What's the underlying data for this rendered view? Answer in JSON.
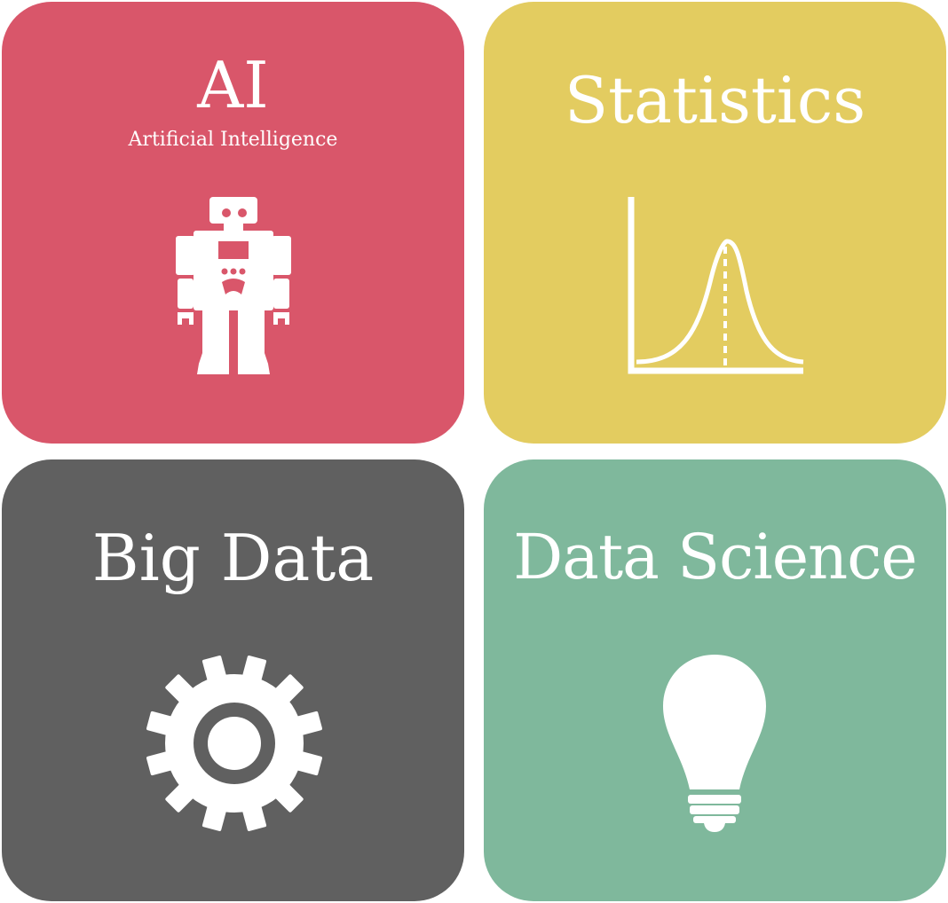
{
  "tiles": {
    "ai": {
      "title": "AI",
      "subtitle": "Artificial Intelligence",
      "color": "#d9566a",
      "icon": "robot-icon"
    },
    "statistics": {
      "title": "Statistics",
      "color": "#e3cc60",
      "icon": "bell-curve-icon"
    },
    "big_data": {
      "title": "Big Data",
      "color": "#606060",
      "icon": "gear-icon"
    },
    "data_science": {
      "title": "Data Science",
      "color": "#7fb89c",
      "icon": "light-bulb-icon"
    }
  }
}
